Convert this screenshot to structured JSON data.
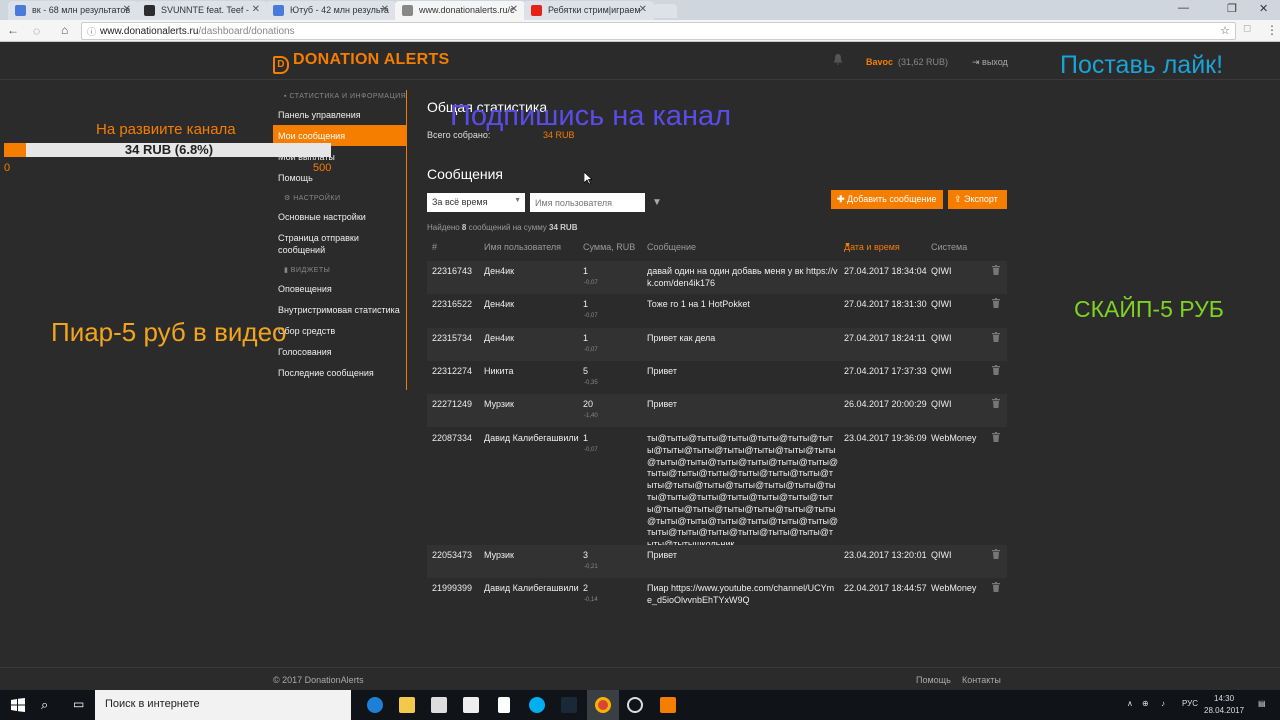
{
  "browser": {
    "tabs": [
      {
        "title": "вк - 68 млн результатов",
        "color": "#4a7bd8"
      },
      {
        "title": "SVUNNTE feat. Teef -",
        "color": "#2d2d2d"
      },
      {
        "title": "Ютуб - 42 млн результа",
        "color": "#4a7bd8"
      },
      {
        "title": "www.donationalerts.ru/c",
        "color": "#888888"
      },
      {
        "title": "Ребятки стрим|играем",
        "color": "#e62117"
      }
    ],
    "url_host": "www.donationalerts.ru",
    "url_path": "/dashboard/donations"
  },
  "header": {
    "logo": "DONATION ALERTS",
    "user": "Bavoc",
    "balance": "(31,62 RUB)",
    "logout": "выход"
  },
  "sidebar": {
    "sections": [
      {
        "title": "СТАТИСТИКА И ИНФОРМАЦИЯ",
        "items": [
          "Панель управления",
          "Мои сообщения",
          "Мои выплаты",
          "Помощь"
        ],
        "active": 1
      },
      {
        "title": "НАСТРОЙКИ",
        "items": [
          "Основные настройки",
          "Страница отправки сообщений"
        ]
      },
      {
        "title": "ВИДЖЕТЫ",
        "items": [
          "Оповещения",
          "Внутристримовая статистика",
          "Сбор средств",
          "Голосования",
          "Последние сообщения"
        ]
      }
    ]
  },
  "stats": {
    "heading": "Общая статистика",
    "collected_label": "Всего собрано:",
    "collected_value": "34 RUB"
  },
  "messages": {
    "heading": "Сообщения",
    "period_select": "За всё время",
    "username_placeholder": "Имя пользователя",
    "add_button": "Добавить сообщение",
    "export_button": "Экспорт",
    "found_prefix": "Найдено",
    "found_count": "8",
    "found_mid": "сообщений на сумму",
    "found_sum": "34 RUB",
    "columns": [
      "#",
      "Имя пользователя",
      "Сумма, RUB",
      "Сообщение",
      "Дата и время",
      "Система"
    ],
    "rows": [
      {
        "id": "22316743",
        "user": "Ден4ик",
        "amount": "1",
        "fee": "-0,07",
        "message": "давай один на один добавь меня у вк https://vk.com/den4ik176",
        "date": "27.04.2017 18:34:04",
        "system": "QIWI"
      },
      {
        "id": "22316522",
        "user": "Ден4ик",
        "amount": "1",
        "fee": "-0,07",
        "message": "Тоже го 1 на 1 HotPokket",
        "date": "27.04.2017 18:31:30",
        "system": "QIWI"
      },
      {
        "id": "22315734",
        "user": "Ден4ик",
        "amount": "1",
        "fee": "-0,07",
        "message": "Привет как дела",
        "date": "27.04.2017 18:24:11",
        "system": "QIWI"
      },
      {
        "id": "22312274",
        "user": "Никита",
        "amount": "5",
        "fee": "-0,35",
        "message": "Привет",
        "date": "27.04.2017 17:37:33",
        "system": "QIWI"
      },
      {
        "id": "22271249",
        "user": "Мурзик",
        "amount": "20",
        "fee": "-1,40",
        "message": "Привет",
        "date": "26.04.2017 20:00:29",
        "system": "QIWI"
      },
      {
        "id": "22087334",
        "user": "Давид Калибегашвили",
        "amount": "1",
        "fee": "-0,07",
        "message": "ты@тыты@тыты@тыты@тыты@тыты@тыты@тыты@тыты@тыты@тыты@тыты@тыты@тыты@тыты@тыты@тыты@тыты@тыты@тыты@тыты@тыты@тыты@тыты@тыты@тыты@тыты@тыты@тыты@тыты@тыты@тыты@тыты@тыты@тыты@тыты@тыты@тыты@тыты@тыты@тыты@тыты@тыты@тыты@тыты@тыты@тыты@тыты@тыты@тыты@тыты@тыты@тыты@тыты@тыты@тыты@тыты@тытышкольник",
        "date": "23.04.2017 19:36:09",
        "system": "WebMoney"
      },
      {
        "id": "22053473",
        "user": "Мурзик",
        "amount": "3",
        "fee": "-0,21",
        "message": "Привет",
        "date": "23.04.2017 13:20:01",
        "system": "QIWI"
      },
      {
        "id": "21999399",
        "user": "Давид Калибегашвили",
        "amount": "2",
        "fee": "-0,14",
        "message": "Пиар https://www.youtube.com/channel/UCYme_d5ioOlvvnbEhTYxW9Q",
        "date": "22.04.2017 18:44:57",
        "system": "WebMoney"
      }
    ]
  },
  "footer": {
    "copyright": "© 2017 DonationAlerts",
    "help": "Помощь",
    "contacts": "Контакты"
  },
  "overlays": {
    "goal_title": "На развиите канала",
    "goal_text": "34 RUB (6.8%)",
    "goal_fraction": 0.068,
    "goal_min": "0",
    "goal_max": "500",
    "subscribe": "Подпишись на канал",
    "like": "Поставь лайк!",
    "promo": "Пиар-5 руб в видео",
    "skype": "СКАЙП-5 РУБ"
  },
  "taskbar": {
    "search_placeholder": "Поиск в интернете",
    "lang": "РУС",
    "time": "14:30",
    "date": "28.04.2017"
  },
  "colors": {
    "accent": "#f57d00",
    "background": "#2b2b2b"
  }
}
